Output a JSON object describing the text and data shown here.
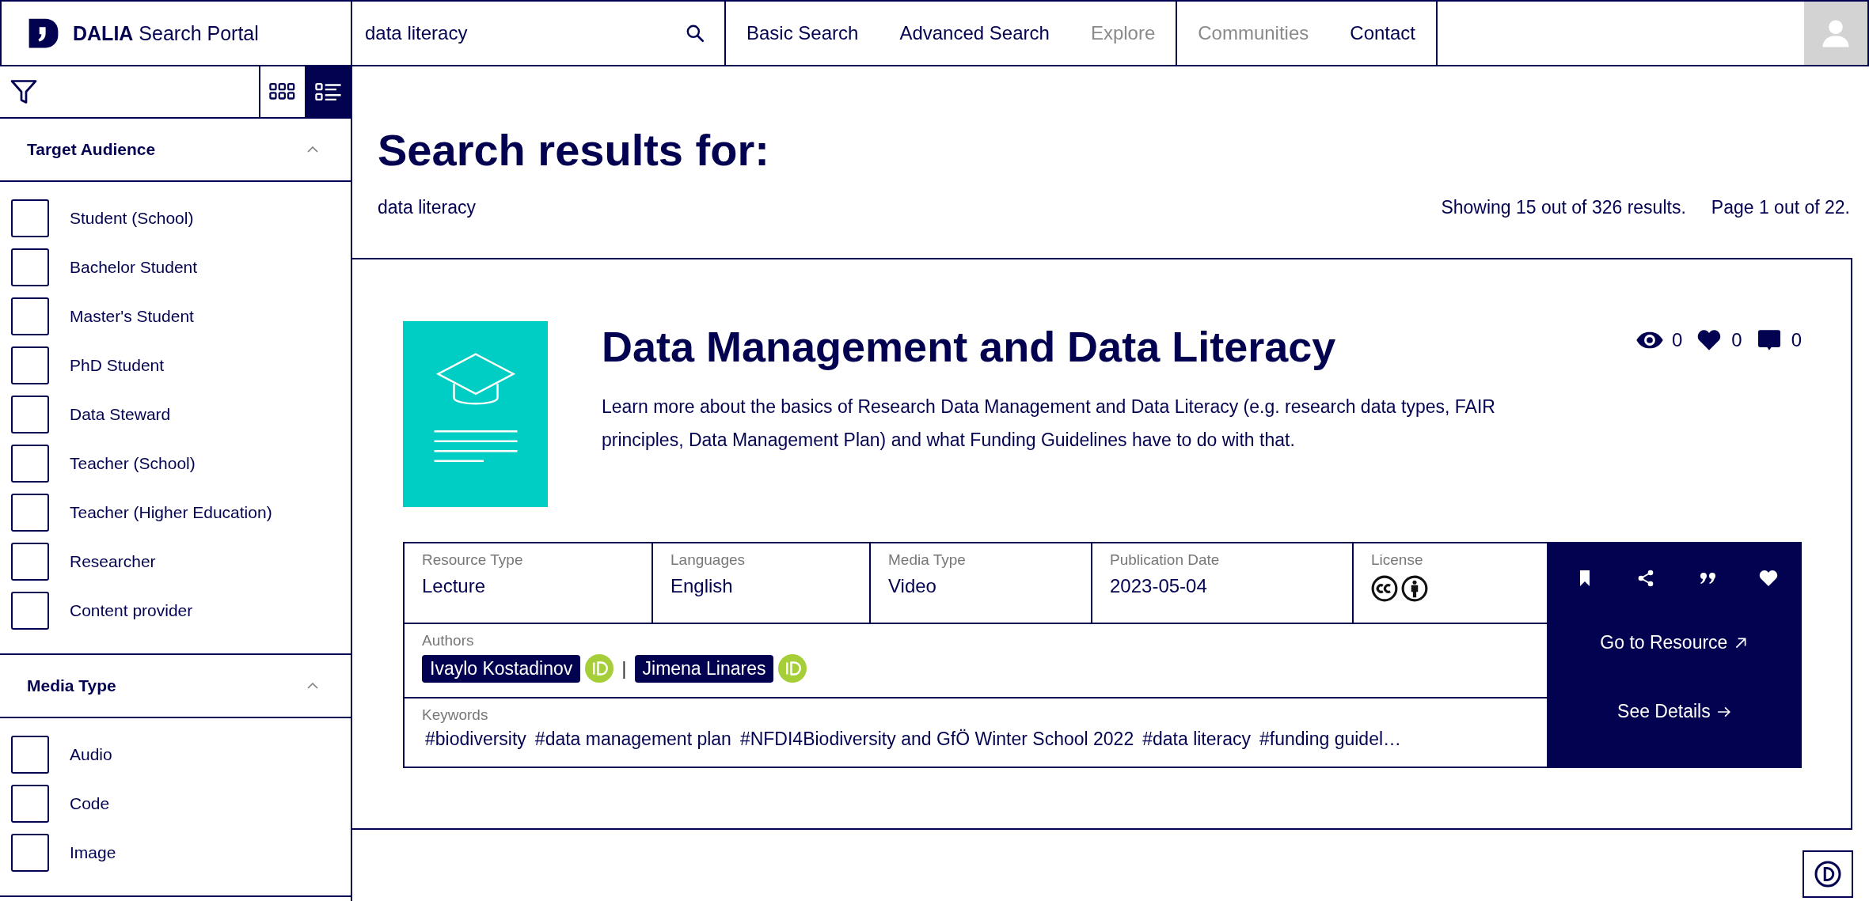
{
  "header": {
    "brand_bold": "DALIA",
    "brand_rest": "Search Portal",
    "search": {
      "value": "data literacy"
    },
    "nav_groups": [
      [
        {
          "label": "Basic Search",
          "disabled": false
        },
        {
          "label": "Advanced Search",
          "disabled": false
        },
        {
          "label": "Explore",
          "disabled": true
        }
      ],
      [
        {
          "label": "Communities",
          "disabled": true
        },
        {
          "label": "Contact",
          "disabled": false
        }
      ]
    ]
  },
  "toolbar": {
    "views": [
      {
        "kind": "grid",
        "selected": false
      },
      {
        "kind": "list",
        "selected": true
      }
    ]
  },
  "filters": [
    {
      "title": "Target Audience",
      "expanded": true,
      "options": [
        {
          "label": "Student (School)",
          "checked": false
        },
        {
          "label": "Bachelor Student",
          "checked": false
        },
        {
          "label": "Master's Student",
          "checked": false
        },
        {
          "label": "PhD Student",
          "checked": false
        },
        {
          "label": "Data Steward",
          "checked": false
        },
        {
          "label": "Teacher (School)",
          "checked": false
        },
        {
          "label": "Teacher (Higher Education)",
          "checked": false
        },
        {
          "label": "Researcher",
          "checked": false
        },
        {
          "label": "Content provider",
          "checked": false
        }
      ]
    },
    {
      "title": "Media Type",
      "expanded": true,
      "options": [
        {
          "label": "Audio",
          "checked": false
        },
        {
          "label": "Code",
          "checked": false
        },
        {
          "label": "Image",
          "checked": false
        }
      ]
    }
  ],
  "results": {
    "heading": "Search results for:",
    "query": "data literacy",
    "summary": "Showing 15 out of 326 results.",
    "page": "Page 1 out of 22."
  },
  "card": {
    "title": "Data Management and Data Literacy",
    "description": "Learn more about the basics of Research Data Management and Data Literacy (e.g. research data types, FAIR principles, Data Management Plan) and what Funding Guidelines have to do with that.",
    "stats": [
      {
        "kind": "views",
        "count": "0"
      },
      {
        "kind": "likes",
        "count": "0"
      },
      {
        "kind": "comments",
        "count": "0"
      }
    ],
    "meta": [
      {
        "label": "Resource Type",
        "value": "Lecture"
      },
      {
        "label": "Languages",
        "value": "English"
      },
      {
        "label": "Media Type",
        "value": "Video"
      },
      {
        "label": "Publication Date",
        "value": "2023-05-04"
      }
    ],
    "license": {
      "label": "License",
      "badges": [
        {
          "kind": "cc"
        },
        {
          "kind": "by"
        }
      ]
    },
    "authors": {
      "label": "Authors",
      "separator": "|",
      "people": [
        {
          "name": "Ivaylo Kostadinov"
        },
        {
          "name": "Jimena Linares"
        }
      ]
    },
    "keywords": {
      "label": "Keywords",
      "items": [
        "#biodiversity",
        "#data management plan",
        "#NFDI4Biodiversity and GfÖ Winter School 2022",
        "#data literacy",
        "#funding guidel…"
      ]
    },
    "actions": [
      {
        "kind": "bookmark"
      },
      {
        "kind": "share"
      },
      {
        "kind": "quote"
      },
      {
        "kind": "heart"
      }
    ],
    "links": [
      {
        "label": "Go to Resource",
        "kind": "external"
      },
      {
        "label": "See Details",
        "kind": "arrow"
      }
    ]
  }
}
